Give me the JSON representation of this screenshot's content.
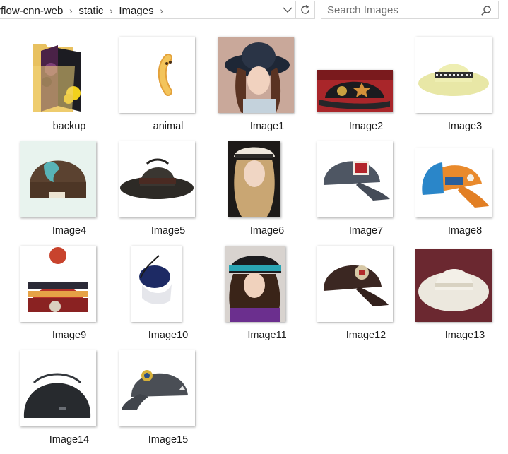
{
  "address_bar": {
    "crumbs": [
      "rflow-cnn-web",
      "static",
      "Images"
    ],
    "separator": "›"
  },
  "search": {
    "placeholder": "Search Images",
    "value": ""
  },
  "items": [
    {
      "label": "backup",
      "kind": "folder"
    },
    {
      "label": "animal",
      "kind": "image"
    },
    {
      "label": "Image1",
      "kind": "image"
    },
    {
      "label": "Image2",
      "kind": "image"
    },
    {
      "label": "Image3",
      "kind": "image"
    },
    {
      "label": "Image4",
      "kind": "image"
    },
    {
      "label": "Image5",
      "kind": "image"
    },
    {
      "label": "Image6",
      "kind": "image"
    },
    {
      "label": "Image7",
      "kind": "image"
    },
    {
      "label": "Image8",
      "kind": "image"
    },
    {
      "label": "Image9",
      "kind": "image"
    },
    {
      "label": "Image10",
      "kind": "image"
    },
    {
      "label": "Image11",
      "kind": "image"
    },
    {
      "label": "Image12",
      "kind": "image"
    },
    {
      "label": "Image13",
      "kind": "image"
    },
    {
      "label": "Image14",
      "kind": "image"
    },
    {
      "label": "Image15",
      "kind": "image"
    }
  ],
  "icons": {
    "dropdown": "chevron-down-icon",
    "refresh": "refresh-icon",
    "search": "search-icon",
    "folder": "folder-icon"
  }
}
